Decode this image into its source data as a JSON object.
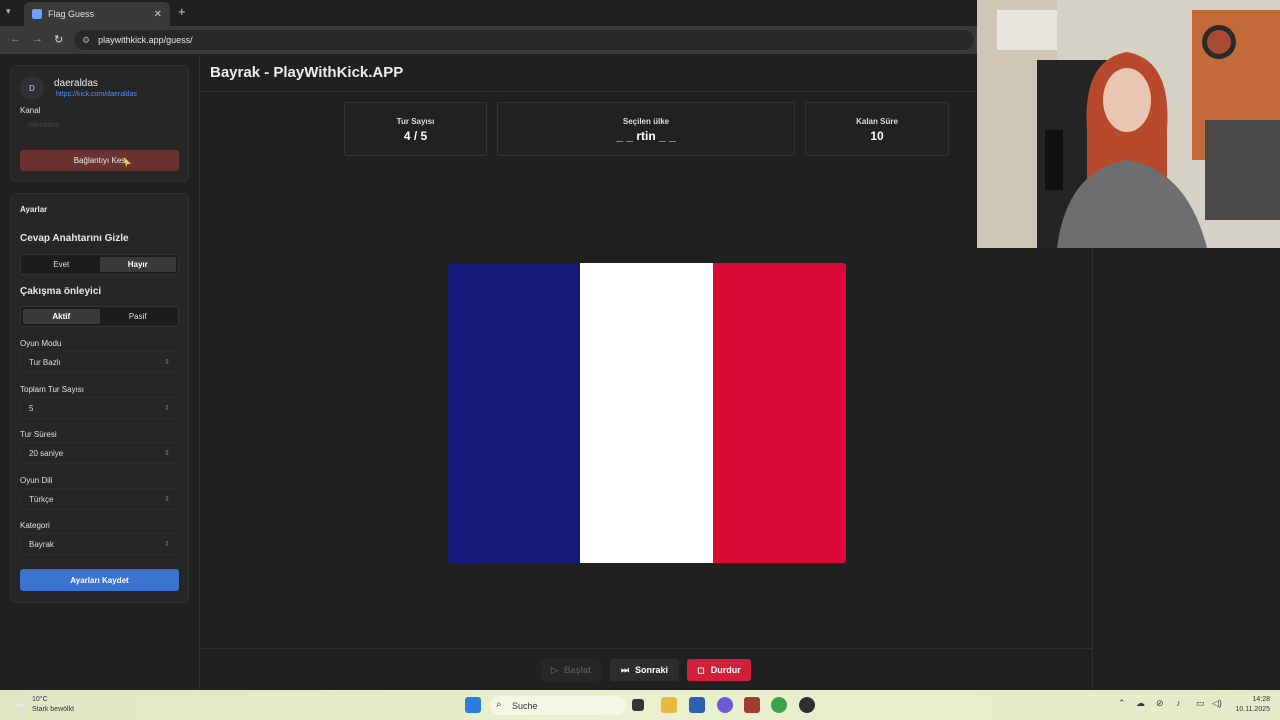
{
  "browser": {
    "tab_title": "Flag Guess",
    "url": "playwithkick.app/guess/"
  },
  "sidebar": {
    "avatar_letter": "D",
    "channel_name": "daeraldas",
    "channel_link": "https://kick.com/daeraldas",
    "channel_label": "Kanal",
    "channel_input_value": "daeraldas",
    "disconnect_label": "Bağlantıyı Kes",
    "settings_title": "Ayarlar",
    "hide_answer_label": "Cevap Anahtarını Gizle",
    "hide_answer_options": [
      "Evet",
      "Hayır"
    ],
    "hide_answer_selected": "Hayır",
    "collision_label": "Çakışma önleyici",
    "collision_options": [
      "Aktif",
      "Pasif"
    ],
    "collision_selected": "Aktif",
    "game_mode_label": "Oyun Modu",
    "game_mode_value": "Tur Bazlı",
    "total_rounds_label": "Toplam Tur Sayısı",
    "total_rounds_value": "5",
    "round_time_label": "Tur Süresi",
    "round_time_value": "20 saniye",
    "language_label": "Oyun Dili",
    "language_value": "Türkçe",
    "category_label": "Kategori",
    "category_value": "Bayrak",
    "save_label": "Ayarları Kaydet"
  },
  "main": {
    "title": "Bayrak - PlayWithKick.APP",
    "stats": {
      "round_label": "Tur Sayısı",
      "round_value": "4 / 5",
      "country_label": "Seçilen ülke",
      "country_value": "_ _ rtin _ _",
      "time_label": "Kalan Süre",
      "time_value": "10"
    },
    "flag_colors": [
      "#151a78",
      "#ffffff",
      "#d90a35"
    ],
    "buttons": {
      "start": "Başlat",
      "next": "Sonraki",
      "stop": "Durdur"
    }
  },
  "taskbar": {
    "temperature": "10°C",
    "weather_text": "Stark bewölkt",
    "search_placeholder": "Suche",
    "time": "14:28",
    "date": "10.11.2025"
  }
}
